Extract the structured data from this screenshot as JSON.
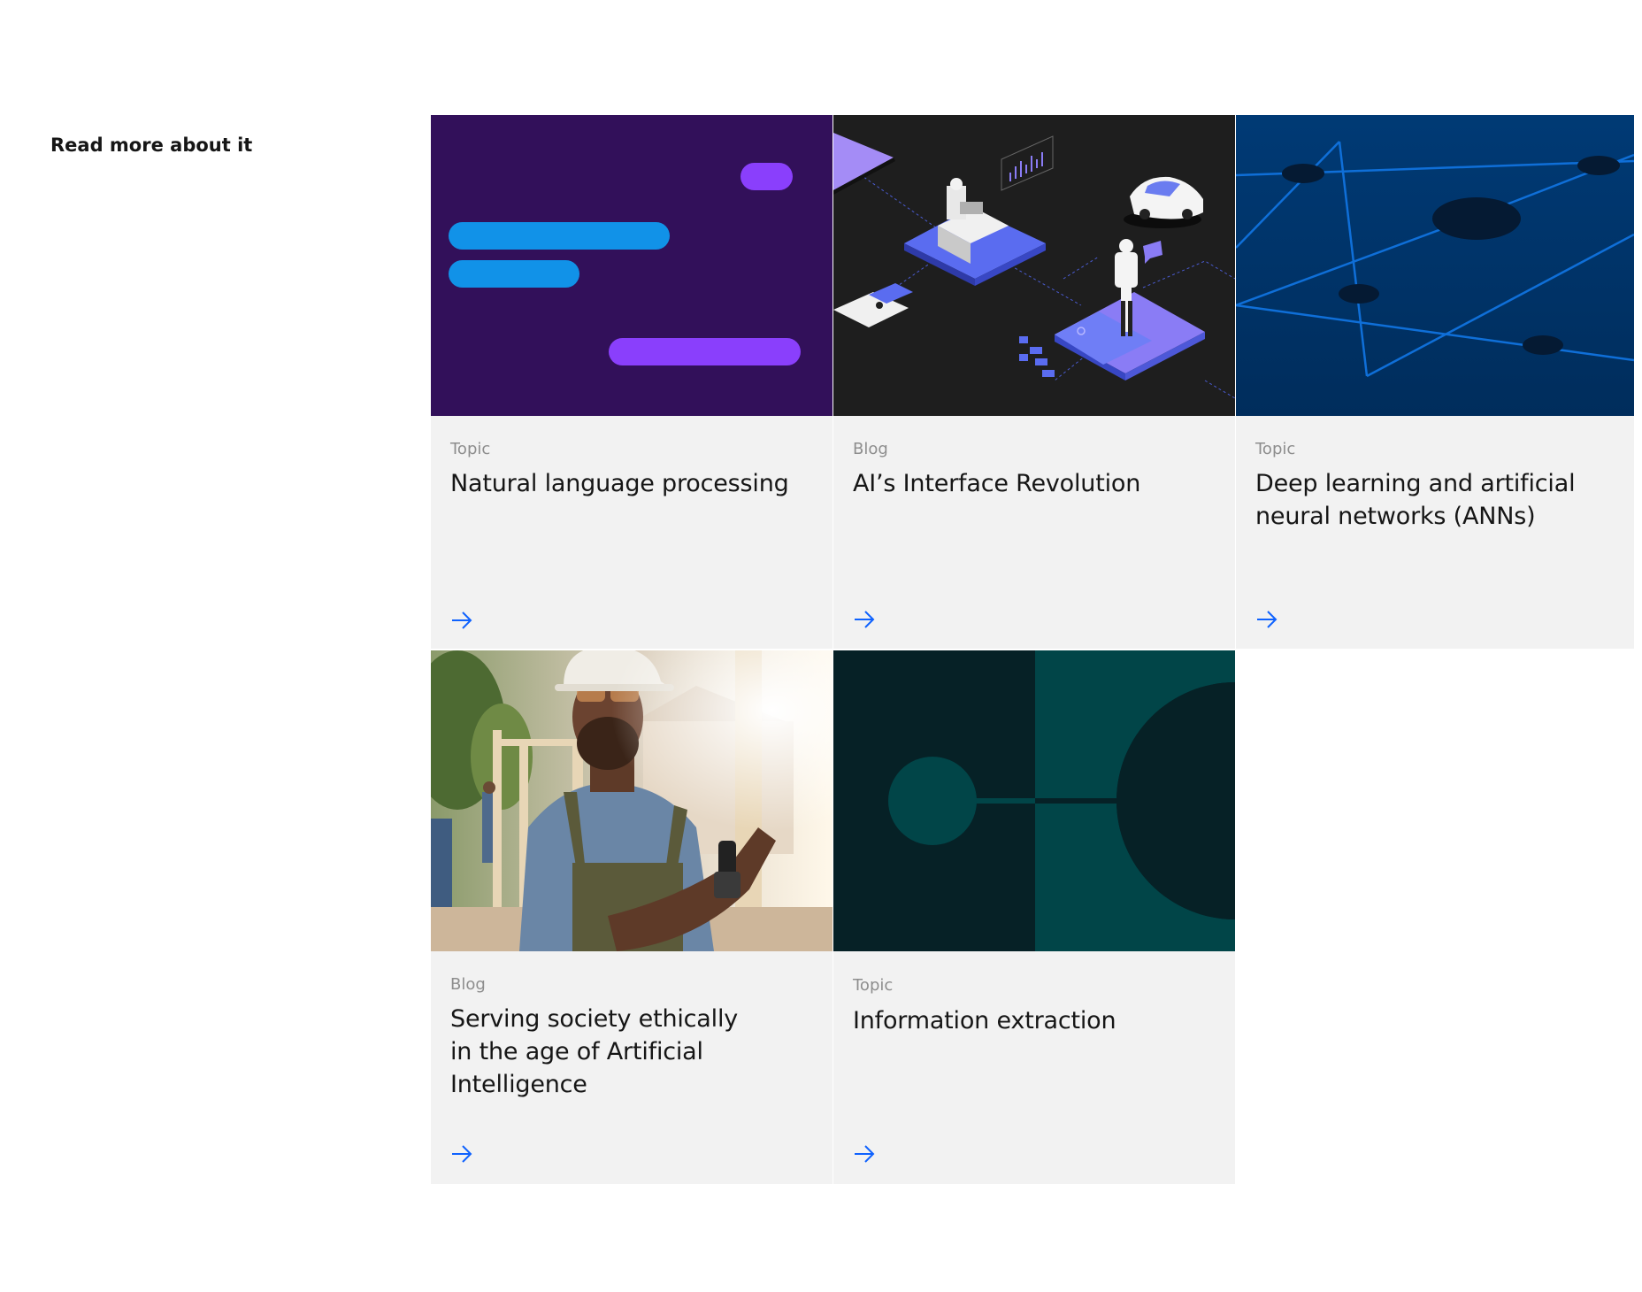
{
  "section": {
    "heading": "Read more about it"
  },
  "cards": [
    {
      "eyebrow": "Topic",
      "title": "Natural language processing",
      "image": "chat-bubbles-illustration",
      "link_icon": "arrow-right-icon"
    },
    {
      "eyebrow": "Blog",
      "title": "AI’s Interface Revolution",
      "image": "isometric-ai-interface-illustration",
      "link_icon": "arrow-right-icon"
    },
    {
      "eyebrow": "Topic",
      "title": "Deep learning and artificial neural networks (ANNs)",
      "image": "neural-network-illustration",
      "link_icon": "arrow-right-icon"
    },
    {
      "eyebrow": "Blog",
      "title": "Serving society ethically in the age of Artificial Intelligence",
      "image": "construction-worker-photo",
      "link_icon": "arrow-right-icon"
    },
    {
      "eyebrow": "Topic",
      "title": "Information extraction",
      "image": "teal-connection-illustration",
      "link_icon": "arrow-right-icon"
    }
  ],
  "colors": {
    "card_background": "#f2f2f2",
    "link": "#0f62fe",
    "eyebrow": "#8d8d8d",
    "title": "#161616"
  }
}
